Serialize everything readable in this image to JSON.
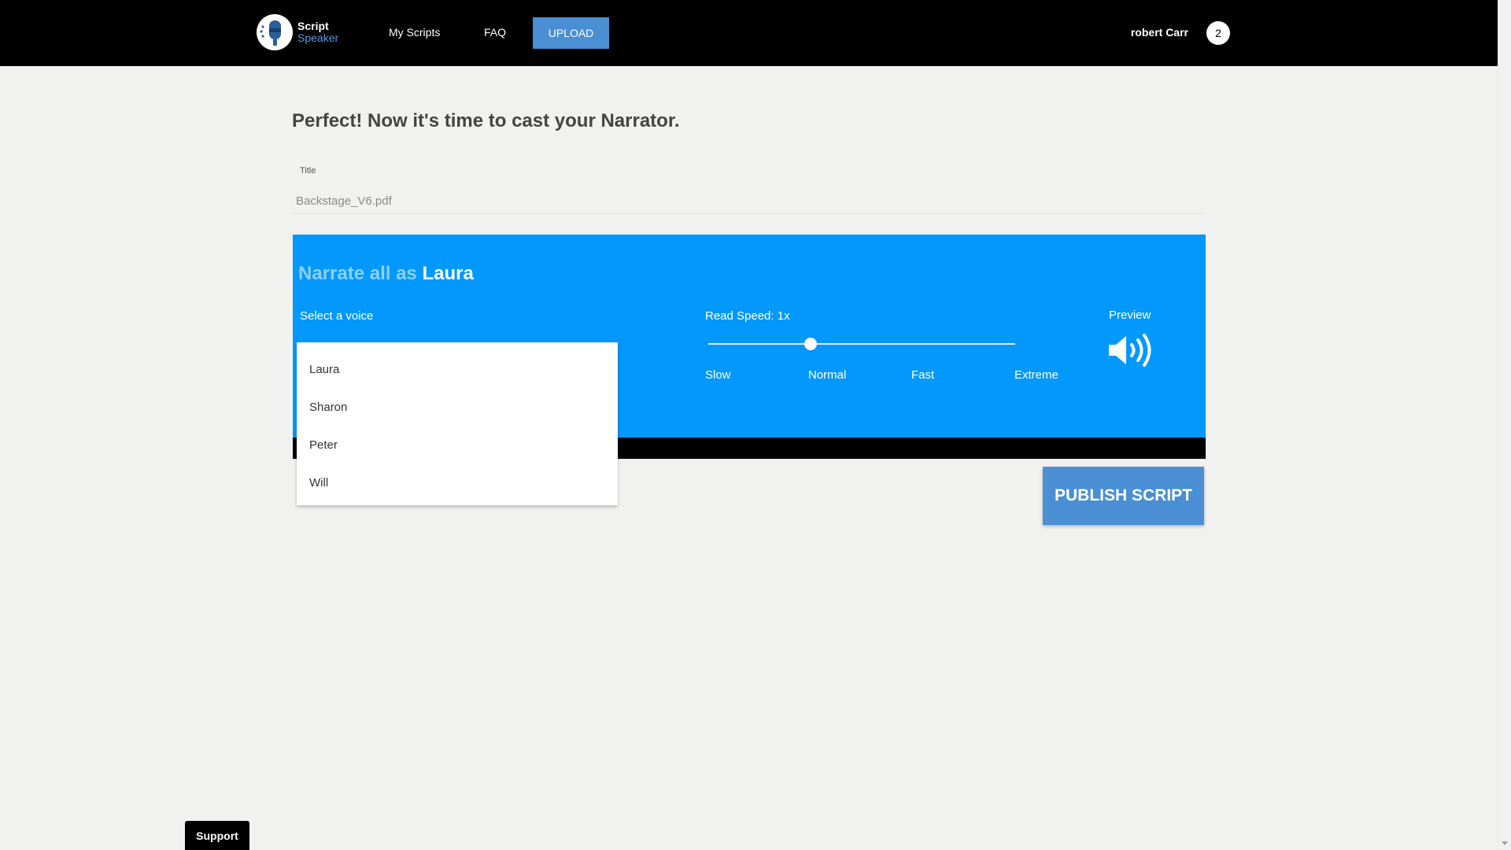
{
  "navbar": {
    "logo_line1": "Script",
    "logo_line2": "Speaker",
    "links": {
      "my_scripts": "My Scripts",
      "faq": "FAQ",
      "upload": "UPLOAD"
    },
    "user_name": "robert Carr",
    "user_badge": "2"
  },
  "page": {
    "heading": "Perfect! Now it's time to cast your Narrator.",
    "title_label": "Title",
    "title_value": "Backstage_V6.pdf"
  },
  "narrator": {
    "title_prefix": "Narrate all as",
    "voice_name": "Laura",
    "select_label": "Select a voice",
    "speed_label": "Read Speed: 1x",
    "speed_value_fraction": 0.333,
    "ticks": [
      "Slow",
      "Normal",
      "Fast",
      "Extreme"
    ],
    "preview_label": "Preview"
  },
  "voice_options": [
    "Laura",
    "Sharon",
    "Peter",
    "Will"
  ],
  "publish_label": "PUBLISH SCRIPT",
  "support_label": "Support",
  "colors": {
    "navbar": "#000000",
    "panel": "#0398fb",
    "accent_button": "#4a8fd4",
    "background": "#f1f1f0"
  }
}
